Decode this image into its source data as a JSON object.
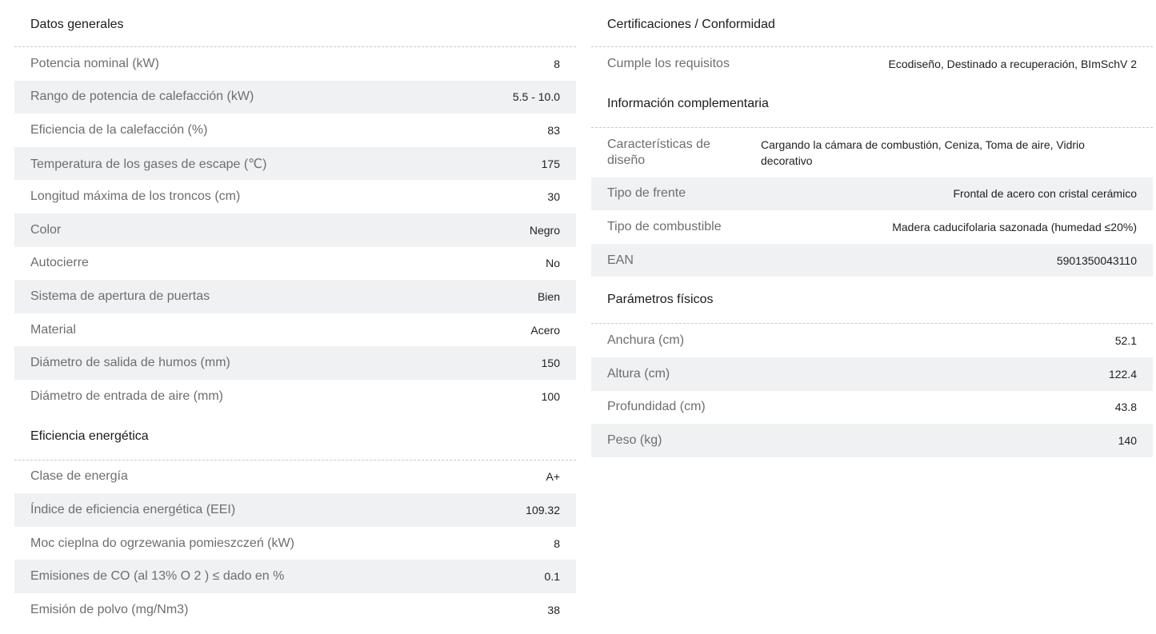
{
  "left": {
    "general": {
      "title": "Datos generales",
      "rows": [
        {
          "label": "Potencia nominal (kW)",
          "value": "8"
        },
        {
          "label": "Rango de potencia de calefacción (kW)",
          "value": "5.5 - 10.0"
        },
        {
          "label": "Eficiencia de la calefacción (%)",
          "value": "83"
        },
        {
          "label": "Temperatura de los gases de escape (℃)",
          "value": "175"
        },
        {
          "label": "Longitud máxima de los troncos (cm)",
          "value": "30"
        },
        {
          "label": "Color",
          "value": "Negro"
        },
        {
          "label": "Autocierre",
          "value": "No"
        },
        {
          "label": "Sistema de apertura de puertas",
          "value": "Bien"
        },
        {
          "label": "Material",
          "value": "Acero"
        },
        {
          "label": "Diámetro de salida de humos (mm)",
          "value": "150"
        },
        {
          "label": "Diámetro de entrada de aire (mm)",
          "value": "100"
        }
      ]
    },
    "energy": {
      "title": "Eficiencia energética",
      "rows": [
        {
          "label": "Clase de energía",
          "value": "A+"
        },
        {
          "label": "Índice de eficiencia energética (EEI)",
          "value": "109.32"
        },
        {
          "label": "Moc cieplna do ogrzewania pomieszczeń (kW)",
          "value": "8"
        },
        {
          "label": "Emisiones de CO (al 13% O 2 ) ≤ dado en %",
          "value": "0.1"
        },
        {
          "label": "Emisión de polvo (mg/Nm3)",
          "value": "38"
        }
      ]
    }
  },
  "right": {
    "certifications": {
      "title": "Certificaciones / Conformidad",
      "rows": [
        {
          "label": "Cumple los requisitos",
          "value": "Ecodiseño, Destinado a recuperación, BImSchV 2"
        }
      ]
    },
    "complementary": {
      "title": "Información complementaria",
      "rows": [
        {
          "label": "Características de diseño",
          "value": "Cargando la cámara de combustión, Ceniza, Toma de aire, Vidrio decorativo"
        },
        {
          "label": "Tipo de frente",
          "value": "Frontal de acero con cristal cerámico"
        },
        {
          "label": "Tipo de combustible",
          "value": "Madera caducifolaria sazonada (humedad ≤20%)"
        },
        {
          "label": "EAN",
          "value": "5901350043110"
        }
      ]
    },
    "physical": {
      "title": "Parámetros físicos",
      "rows": [
        {
          "label": "Anchura (cm)",
          "value": "52.1"
        },
        {
          "label": "Altura (cm)",
          "value": "122.4"
        },
        {
          "label": "Profundidad (cm)",
          "value": "43.8"
        },
        {
          "label": "Peso (kg)",
          "value": "140"
        }
      ]
    }
  }
}
